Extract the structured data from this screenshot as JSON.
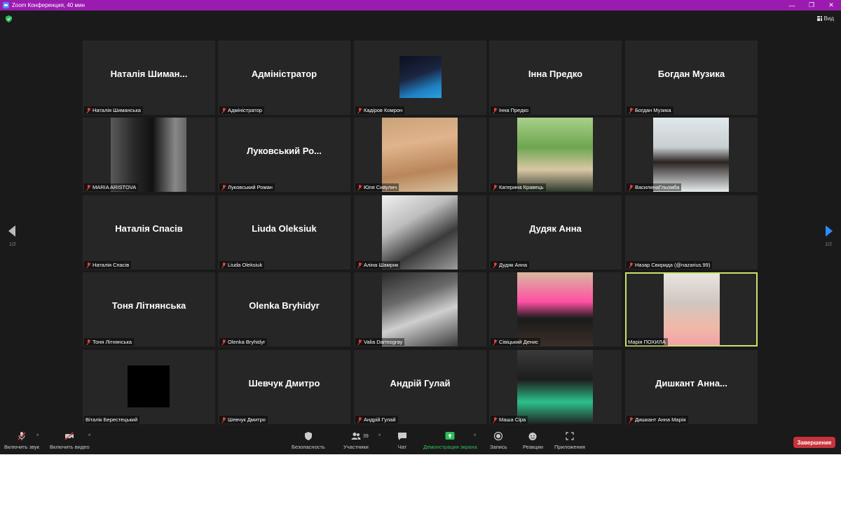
{
  "window": {
    "title": "Zoom Конференция, 40 мин"
  },
  "header": {
    "view_label": "Вид"
  },
  "pager": {
    "left": "1/2",
    "right": "1/2"
  },
  "tiles": [
    {
      "big": "Наталія  Шиман...",
      "label": "Наталія Шиманська",
      "muted": true
    },
    {
      "big": "Адміністратор",
      "label": "Адміністратор",
      "muted": true
    },
    {
      "big": "",
      "label": "Кадіров Комрон",
      "muted": true,
      "photo": true
    },
    {
      "big": "Інна Предко",
      "label": "Інна Предко",
      "muted": true
    },
    {
      "big": "Богдан Музика",
      "label": "Богдан Музика",
      "muted": true
    },
    {
      "big": "",
      "label": "MARIA ARISTOVA",
      "muted": true,
      "photo": true
    },
    {
      "big": "Луковський  Ро...",
      "label": "Луковський Роман",
      "muted": true
    },
    {
      "big": "",
      "label": "Юля Сивулич",
      "muted": true,
      "photo": true
    },
    {
      "big": "",
      "label": "Катерина Кравець",
      "muted": true,
      "photo": true
    },
    {
      "big": "",
      "label": "ВасилинаГльомба",
      "muted": true,
      "photo": true
    },
    {
      "big": "Наталія Спасів",
      "label": "Наталія Спасів",
      "muted": true
    },
    {
      "big": "Liuda Oleksiuk",
      "label": "Liuda Oleksiuk",
      "muted": true
    },
    {
      "big": "",
      "label": "Аліна Шамрик",
      "muted": true,
      "photo": true
    },
    {
      "big": "Дудяк Анна",
      "label": "Дудяк Анна",
      "muted": true
    },
    {
      "big": "",
      "label": "Назар Свирида (@nazarius.99)",
      "muted": true
    },
    {
      "big": "Тоня Літнянська",
      "label": "Тоня Літнянська",
      "muted": true
    },
    {
      "big": "Olenka Bryhidyr",
      "label": "Olenka Bryhidyr",
      "muted": true
    },
    {
      "big": "",
      "label": "Valia Darmogray",
      "muted": true,
      "photo": true
    },
    {
      "big": "",
      "label": "Сівіцький Денис",
      "muted": true,
      "photo": true
    },
    {
      "big": "",
      "label": "Марія ПОХИЛА",
      "muted": false,
      "photo": true,
      "active": true
    },
    {
      "big": "",
      "label": "Віталік Берестецький",
      "muted": false,
      "photo": true
    },
    {
      "big": "Шевчук Дмитро",
      "label": "Шевчук Дмитро",
      "muted": true
    },
    {
      "big": "Андрій Гулай",
      "label": "Андрій Гулай",
      "muted": true
    },
    {
      "big": "",
      "label": "Маша Сіра",
      "muted": true,
      "photo": true
    },
    {
      "big": "Дишкант  Анна...",
      "label": "Дишкант Анна Марія",
      "muted": true
    }
  ],
  "toolbar": {
    "audio": "Включить звук",
    "video": "Включить видео",
    "security": "Безопасность",
    "participants": "Участники",
    "participants_count": "39",
    "chat": "Чат",
    "share": "Демонстрация экрана",
    "record": "Запись",
    "reactions": "Реакции",
    "apps": "Приложения",
    "end": "Завершение"
  },
  "colors": {
    "titlebar": "#9b1bb1",
    "active_speaker": "#c8e46a",
    "share_green": "#2cbd5a",
    "end_red": "#c7333c"
  }
}
